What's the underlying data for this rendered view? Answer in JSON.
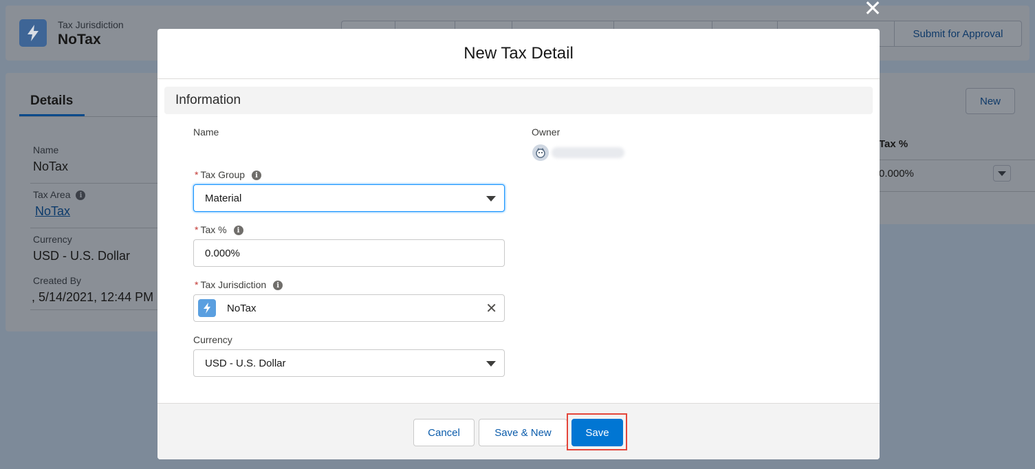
{
  "record_header": {
    "entity_label": "Tax Jurisdiction",
    "title": "NoTax",
    "actions": [
      "",
      "",
      "",
      "",
      "",
      "",
      "",
      "Submit for Approval"
    ]
  },
  "details_card": {
    "tab_label": "Details",
    "fields": [
      {
        "label": "Name",
        "value": "NoTax"
      },
      {
        "label": "Tax Area",
        "value": "NoTax",
        "is_link": true,
        "has_info": true
      },
      {
        "label": "Currency",
        "value": "USD - U.S. Dollar"
      },
      {
        "label": "Created By",
        "value": ", 5/14/2021, 12:44 PM"
      }
    ]
  },
  "related_card": {
    "new_button": "New",
    "column_header": "Tax %",
    "row_value": "0.000%"
  },
  "modal": {
    "title": "New Tax Detail",
    "close_icon": "close-icon",
    "section_title": "Information",
    "name_label": "Name",
    "owner_label": "Owner",
    "tax_group": {
      "label": "Tax Group",
      "required": true,
      "value": "Material"
    },
    "tax_percent": {
      "label": "Tax %",
      "required": true,
      "value": "0.000%"
    },
    "tax_jurisdiction": {
      "label": "Tax Jurisdiction",
      "required": true,
      "value": "NoTax"
    },
    "currency": {
      "label": "Currency",
      "value": "USD - U.S. Dollar"
    },
    "footer": {
      "cancel_label": "Cancel",
      "save_new_label": "Save & New",
      "save_label": "Save"
    }
  },
  "colors": {
    "brand": "#0176d3",
    "focus": "#1b96ff",
    "required": "#c23934",
    "highlight": "#e4453a"
  }
}
